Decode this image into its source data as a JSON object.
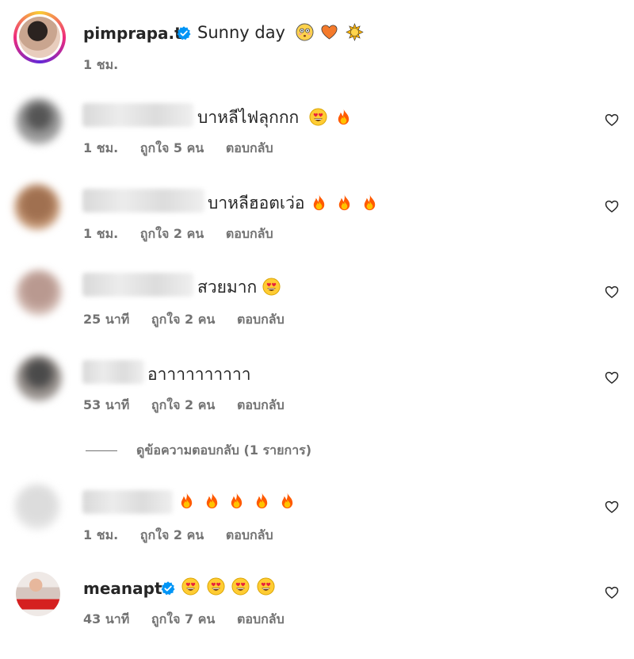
{
  "post": {
    "username": "pimprapa.t",
    "caption": "Sunny day",
    "caption_emojis": [
      "flushed-face",
      "orange-heart",
      "sun"
    ],
    "time": "1 ชม."
  },
  "comments": [
    {
      "text": "บาหลีไฟลุกกก",
      "emojis": [
        "heart-eyes",
        "fire"
      ],
      "time": "1 ชม.",
      "likes": "ถูกใจ 5 คน",
      "reply": "ตอบกลับ"
    },
    {
      "text": "บาหลีฮอตเว่อ",
      "emojis": [
        "fire",
        "fire",
        "fire"
      ],
      "time": "1 ชม.",
      "likes": "ถูกใจ 2 คน",
      "reply": "ตอบกลับ"
    },
    {
      "text": "สวยมาก",
      "emojis": [
        "heart-eyes"
      ],
      "time": "25 นาที",
      "likes": "ถูกใจ 2 คน",
      "reply": "ตอบกลับ"
    },
    {
      "text": "อาาาาาาาาาา",
      "emojis": [],
      "time": "53 นาที",
      "likes": "ถูกใจ 2 คน",
      "reply": "ตอบกลับ"
    },
    {
      "text": "",
      "emojis": [
        "fire",
        "fire",
        "fire",
        "fire",
        "fire"
      ],
      "time": "1 ชม.",
      "likes": "ถูกใจ 2 คน",
      "reply": "ตอบกลับ"
    },
    {
      "username": "meanapt",
      "text": "",
      "emojis": [
        "heart-eyes",
        "heart-eyes",
        "heart-eyes",
        "heart-eyes"
      ],
      "time": "43 นาที",
      "likes": "ถูกใจ 7 คน",
      "reply": "ตอบกลับ"
    }
  ],
  "view_replies": "ดูข้อความตอบกลับ (1 รายการ)",
  "colors": {
    "verified": "#0095f6",
    "fire": "#ff6a00",
    "meta": "#737373"
  }
}
